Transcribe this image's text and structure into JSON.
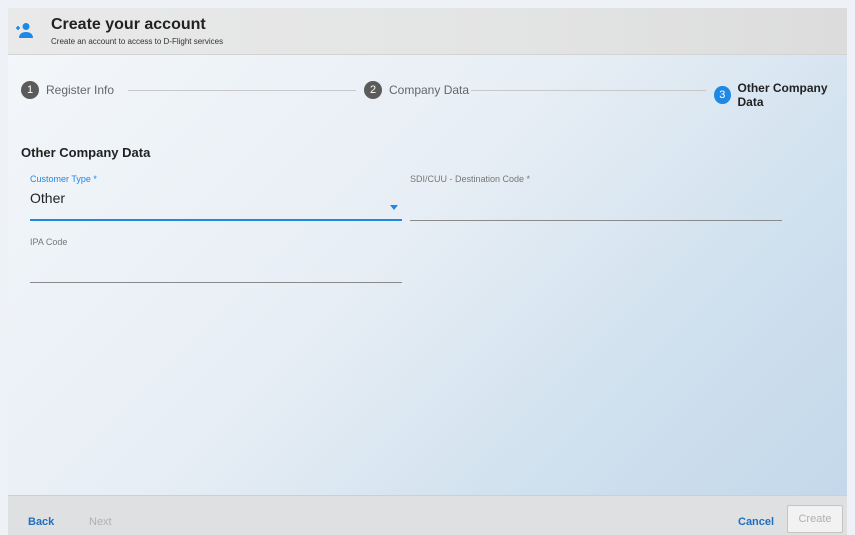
{
  "header": {
    "title": "Create your account",
    "subtitle": "Create an account to access to D-Flight services",
    "icon": "add-user-icon"
  },
  "stepper": {
    "steps": [
      {
        "number": "1",
        "label": "Register Info",
        "active": false
      },
      {
        "number": "2",
        "label": "Company Data",
        "active": false
      },
      {
        "number": "3",
        "label": "Other Company Data",
        "active": true
      }
    ]
  },
  "form": {
    "section_title": "Other Company Data",
    "customer_type": {
      "label": "Customer Type *",
      "value": "Other"
    },
    "sdi_code": {
      "label": "SDI/CUU - Destination Code *",
      "value": ""
    },
    "ipa_code": {
      "label": "IPA Code",
      "value": ""
    }
  },
  "footer": {
    "back_label": "Back",
    "next_label": "Next",
    "cancel_label": "Cancel",
    "create_label": "Create"
  },
  "colors": {
    "accent": "#1e88e5",
    "link": "#1e6fc0",
    "disabled": "#b0b0b0"
  }
}
